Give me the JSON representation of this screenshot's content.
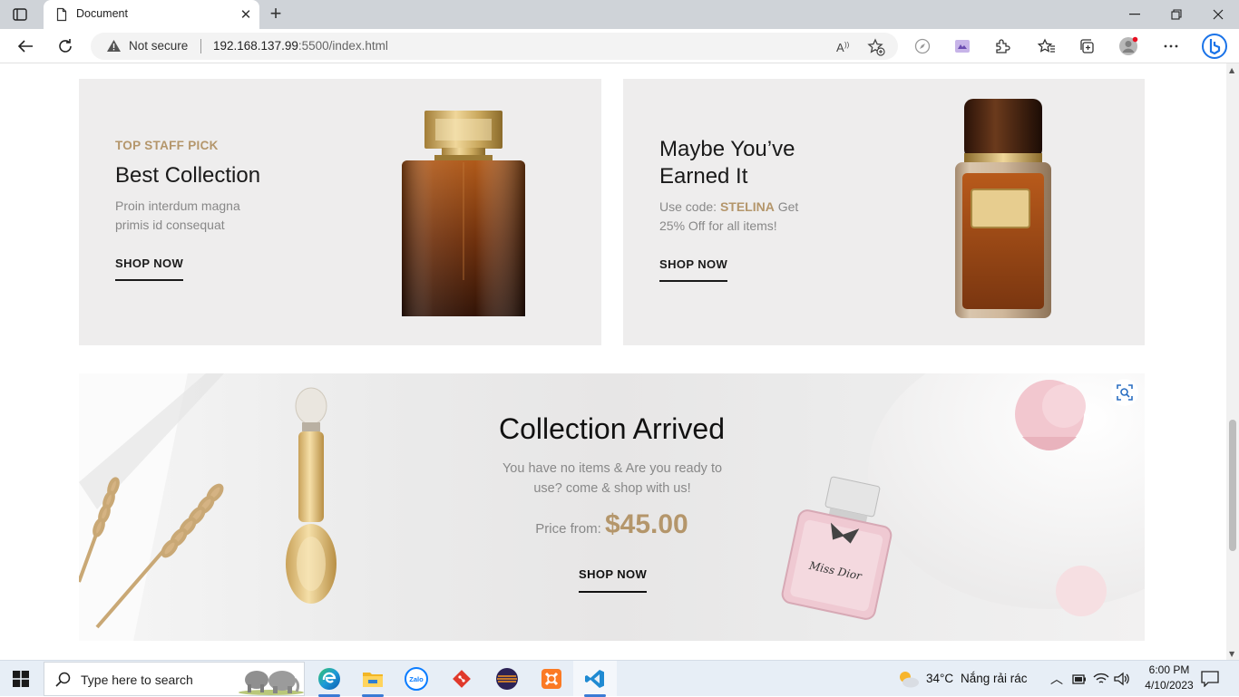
{
  "browser": {
    "tab_title": "Document",
    "address": {
      "security_label": "Not secure",
      "host": "192.168.137.99",
      "path": ":5500/index.html"
    }
  },
  "promo_cards": [
    {
      "eyebrow": "TOP STAFF PICK",
      "title": "Best Collection",
      "desc": "Proin interdum magna primis id consequat",
      "cta": "SHOP NOW"
    },
    {
      "title_line1": "Maybe You’ve",
      "title_line2": "Earned It",
      "desc_prefix": "Use code: ",
      "code": "STELINA",
      "desc_suffix": " Get 25% Off for all items!",
      "cta": "SHOP NOW"
    }
  ],
  "banner": {
    "title": "Collection Arrived",
    "desc": "You have no items & Are you ready to use? come & shop with us!",
    "price_label": "Price from: ",
    "price_value": "$45.00",
    "cta": "SHOP NOW",
    "bottle_text": "Miss Dior"
  },
  "taskbar": {
    "search_placeholder": "Type here to search",
    "weather_temp": "34°C",
    "weather_desc": "Nắng rải rác",
    "time": "6:00 PM",
    "date": "4/10/2023"
  },
  "colors": {
    "accent_gold": "#b4966b",
    "card_bg": "#eeeded",
    "text_dark": "#1a1a1a",
    "text_muted": "#888888"
  }
}
